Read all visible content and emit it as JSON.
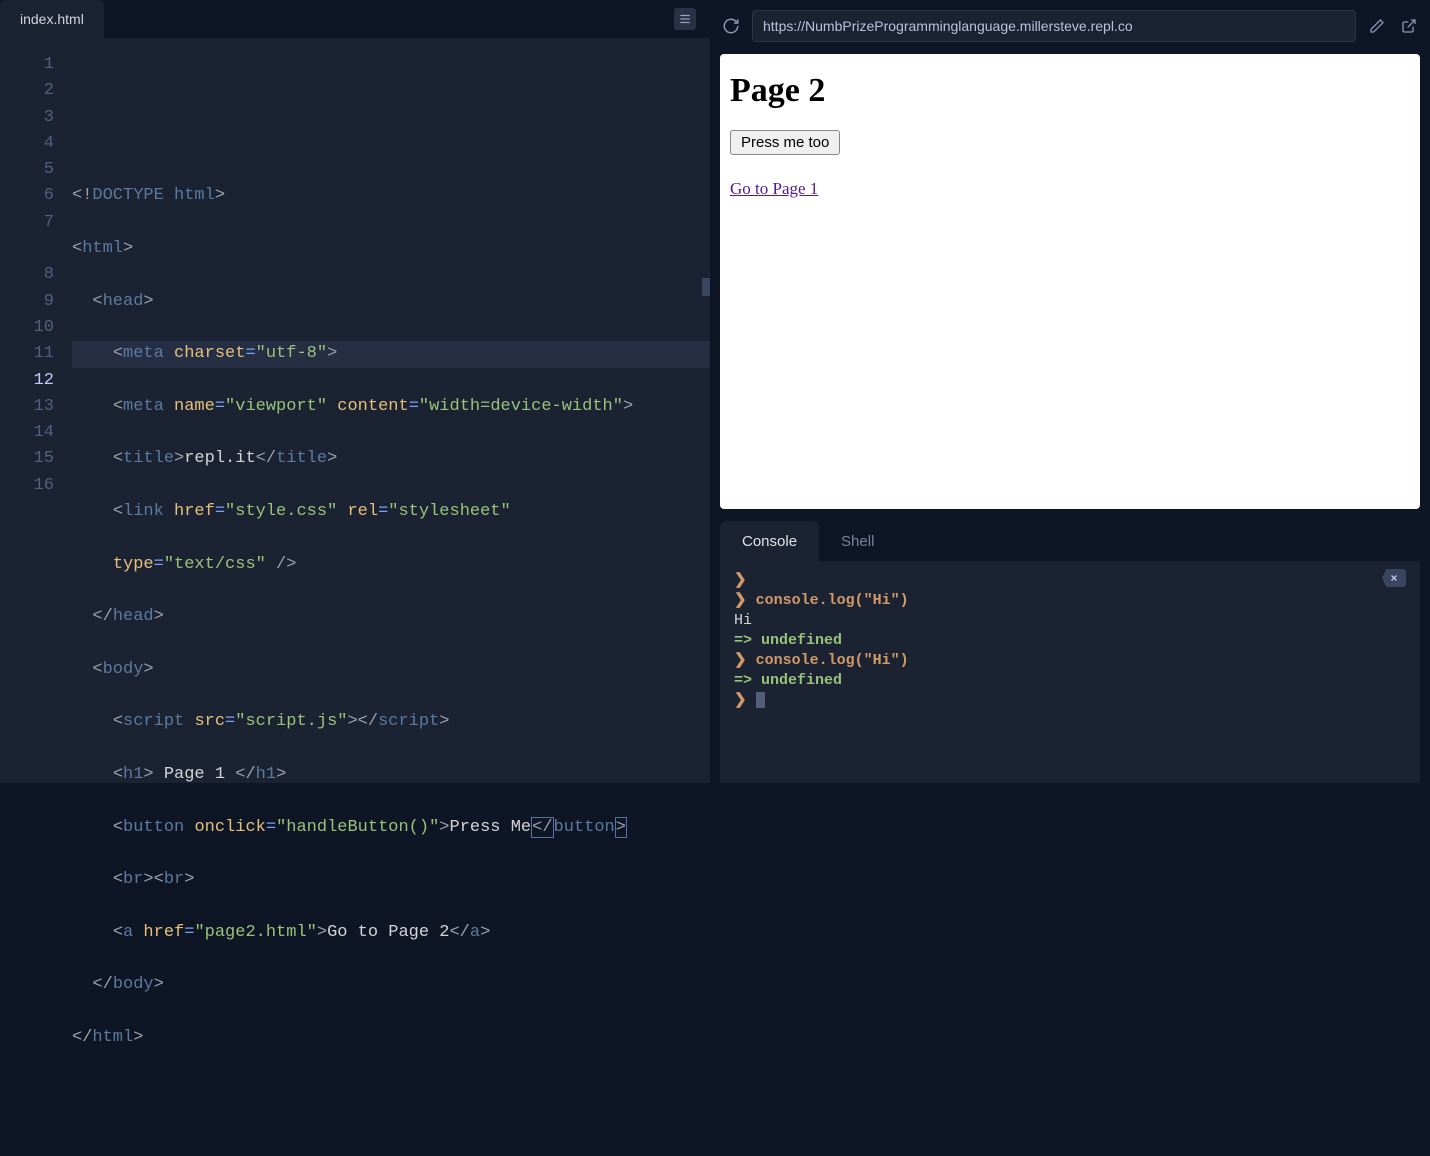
{
  "editor": {
    "tab_label": "index.html",
    "line_numbers": [
      "1",
      "2",
      "3",
      "4",
      "5",
      "6",
      "7",
      "8",
      "9",
      "10",
      "11",
      "12",
      "13",
      "14",
      "15",
      "16"
    ],
    "current_line": 12,
    "code": {
      "l1": {
        "doctype": "<!DOCTYPE html>"
      },
      "l2": {
        "open": "<",
        "tag": "html",
        "close": ">"
      },
      "l3": {
        "open": "<",
        "tag": "head",
        "close": ">"
      },
      "l4": {
        "open": "<",
        "tag": "meta",
        "attr": "charset",
        "eq": "=",
        "val": "\"utf-8\"",
        "close": ">"
      },
      "l5": {
        "open": "<",
        "tag": "meta",
        "attr1": "name",
        "val1": "\"viewport\"",
        "attr2": "content",
        "val2": "\"width=device-width\"",
        "close": ">"
      },
      "l6": {
        "open": "<",
        "tag": "title",
        "close": ">",
        "text": "repl.it",
        "open2": "</",
        "tag2": "title",
        "close2": ">"
      },
      "l7a": {
        "open": "<",
        "tag": "link",
        "attr1": "href",
        "val1": "\"style.css\"",
        "attr2": "rel",
        "val2": "\"stylesheet\""
      },
      "l7b": {
        "attr": "type",
        "val": "\"text/css\"",
        "close": " />"
      },
      "l8": {
        "open": "</",
        "tag": "head",
        "close": ">"
      },
      "l9": {
        "open": "<",
        "tag": "body",
        "close": ">"
      },
      "l10": {
        "open": "<",
        "tag": "script",
        "attr": "src",
        "val": "\"script.js\"",
        "close": ">",
        "open2": "</",
        "tag2": "script",
        "close2": ">"
      },
      "l11": {
        "open": "<",
        "tag": "h1",
        "close": ">",
        "text": " Page 1 ",
        "open2": "</",
        "tag2": "h1",
        "close2": ">"
      },
      "l12": {
        "open": "<",
        "tag": "button",
        "attr": "onclick",
        "val": "\"handleButton()\"",
        "close": ">",
        "text": "Press Me",
        "open2": "</",
        "tag2": "button",
        "close2": ">"
      },
      "l13a": {
        "open": "<",
        "tag": "br",
        "close": ">"
      },
      "l13b": {
        "open": "<",
        "tag": "br",
        "close": ">"
      },
      "l14": {
        "open": "<",
        "tag": "a",
        "attr": "href",
        "val": "\"page2.html\"",
        "close": ">",
        "text": "Go to Page 2",
        "open2": "</",
        "tag2": "a",
        "close2": ">"
      },
      "l15": {
        "open": "</",
        "tag": "body",
        "close": ">"
      },
      "l16": {
        "open": "</",
        "tag": "html",
        "close": ">"
      }
    }
  },
  "browser": {
    "url": "https://NumbPrizeProgramminglanguage.millersteve.repl.co"
  },
  "preview": {
    "heading": "Page 2",
    "button_label": "Press me too",
    "link_text": "Go to Page 1"
  },
  "console": {
    "tab_console": "Console",
    "tab_shell": "Shell",
    "lines": [
      {
        "prompt": "❯",
        "cmd": ""
      },
      {
        "prompt": "❯",
        "cmd": " console.log(\"Hi\")"
      },
      {
        "out": "Hi"
      },
      {
        "arrow": "=>",
        "val": " undefined"
      },
      {
        "prompt": "❯",
        "cmd": " console.log(\"Hi\")"
      },
      {
        "arrow": "=>",
        "val": " undefined"
      },
      {
        "prompt": "❯",
        "cursor": true
      }
    ]
  }
}
